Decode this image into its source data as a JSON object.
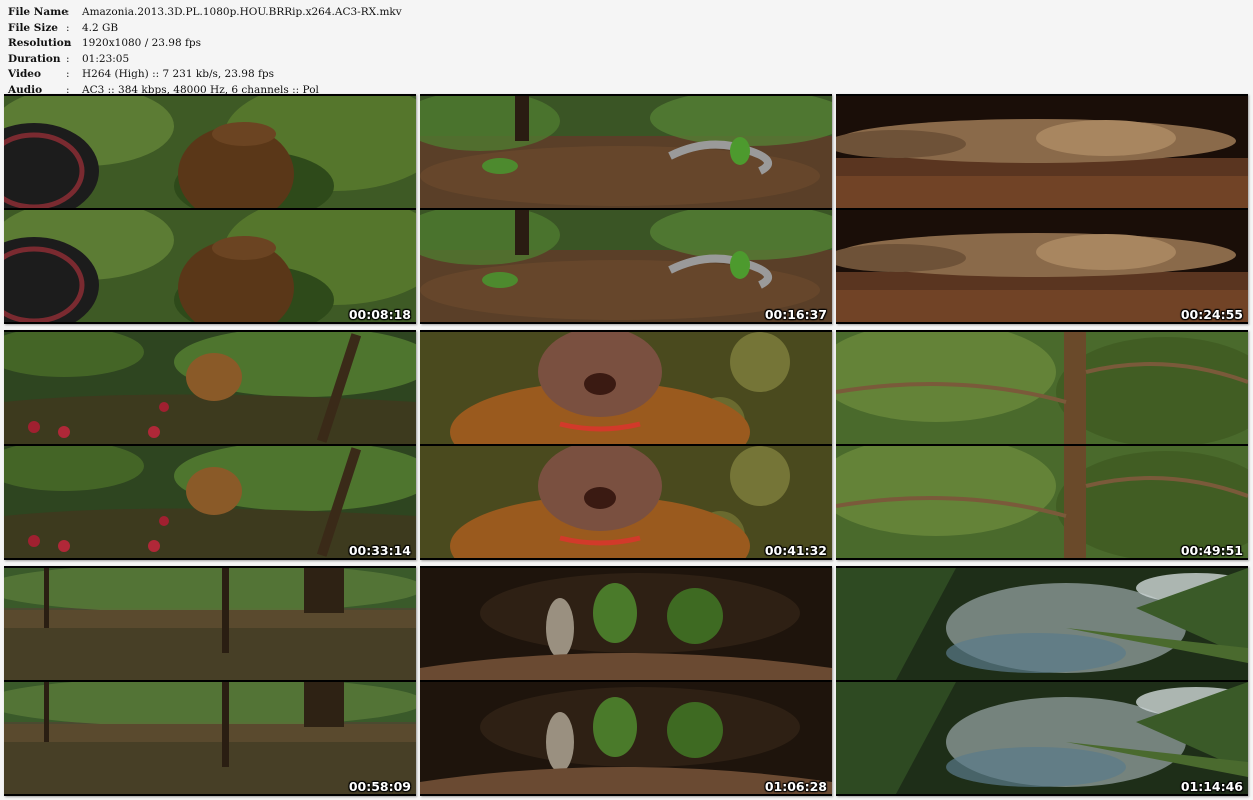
{
  "info": [
    {
      "key": "File Name",
      "sep": ":",
      "value": "Amazonia.2013.3D.PL.1080p.HOU.BRRip.x264.AC3-RX.mkv"
    },
    {
      "key": "File Size",
      "sep": ":",
      "value": "4.2 GB"
    },
    {
      "key": "Resolution",
      "sep": ":",
      "value": "1920x1080 / 23.98 fps"
    },
    {
      "key": "Duration",
      "sep": ":",
      "value": "01:23:05"
    },
    {
      "key": "Video",
      "sep": ":",
      "value": "H264 (High) :: 7 231 kb/s, 23.98 fps"
    },
    {
      "key": "Audio",
      "sep": ":",
      "value": "AC3 :: 384 kbps, 48000 Hz, 6 channels :: Pol"
    }
  ],
  "thumbnails": [
    {
      "timestamp": "00:08:18",
      "scene": "monkey-wheel"
    },
    {
      "timestamp": "00:16:37",
      "scene": "snake-forest-floor"
    },
    {
      "timestamp": "00:24:55",
      "scene": "caiman-water"
    },
    {
      "timestamp": "00:33:14",
      "scene": "monkey-log-berries"
    },
    {
      "timestamp": "00:41:32",
      "scene": "monkey-closeup-collar"
    },
    {
      "timestamp": "00:49:51",
      "scene": "tree-canopy"
    },
    {
      "timestamp": "00:58:09",
      "scene": "flooded-forest"
    },
    {
      "timestamp": "01:06:28",
      "scene": "cave-arch"
    },
    {
      "timestamp": "01:14:46",
      "scene": "jungle-smoke"
    }
  ]
}
